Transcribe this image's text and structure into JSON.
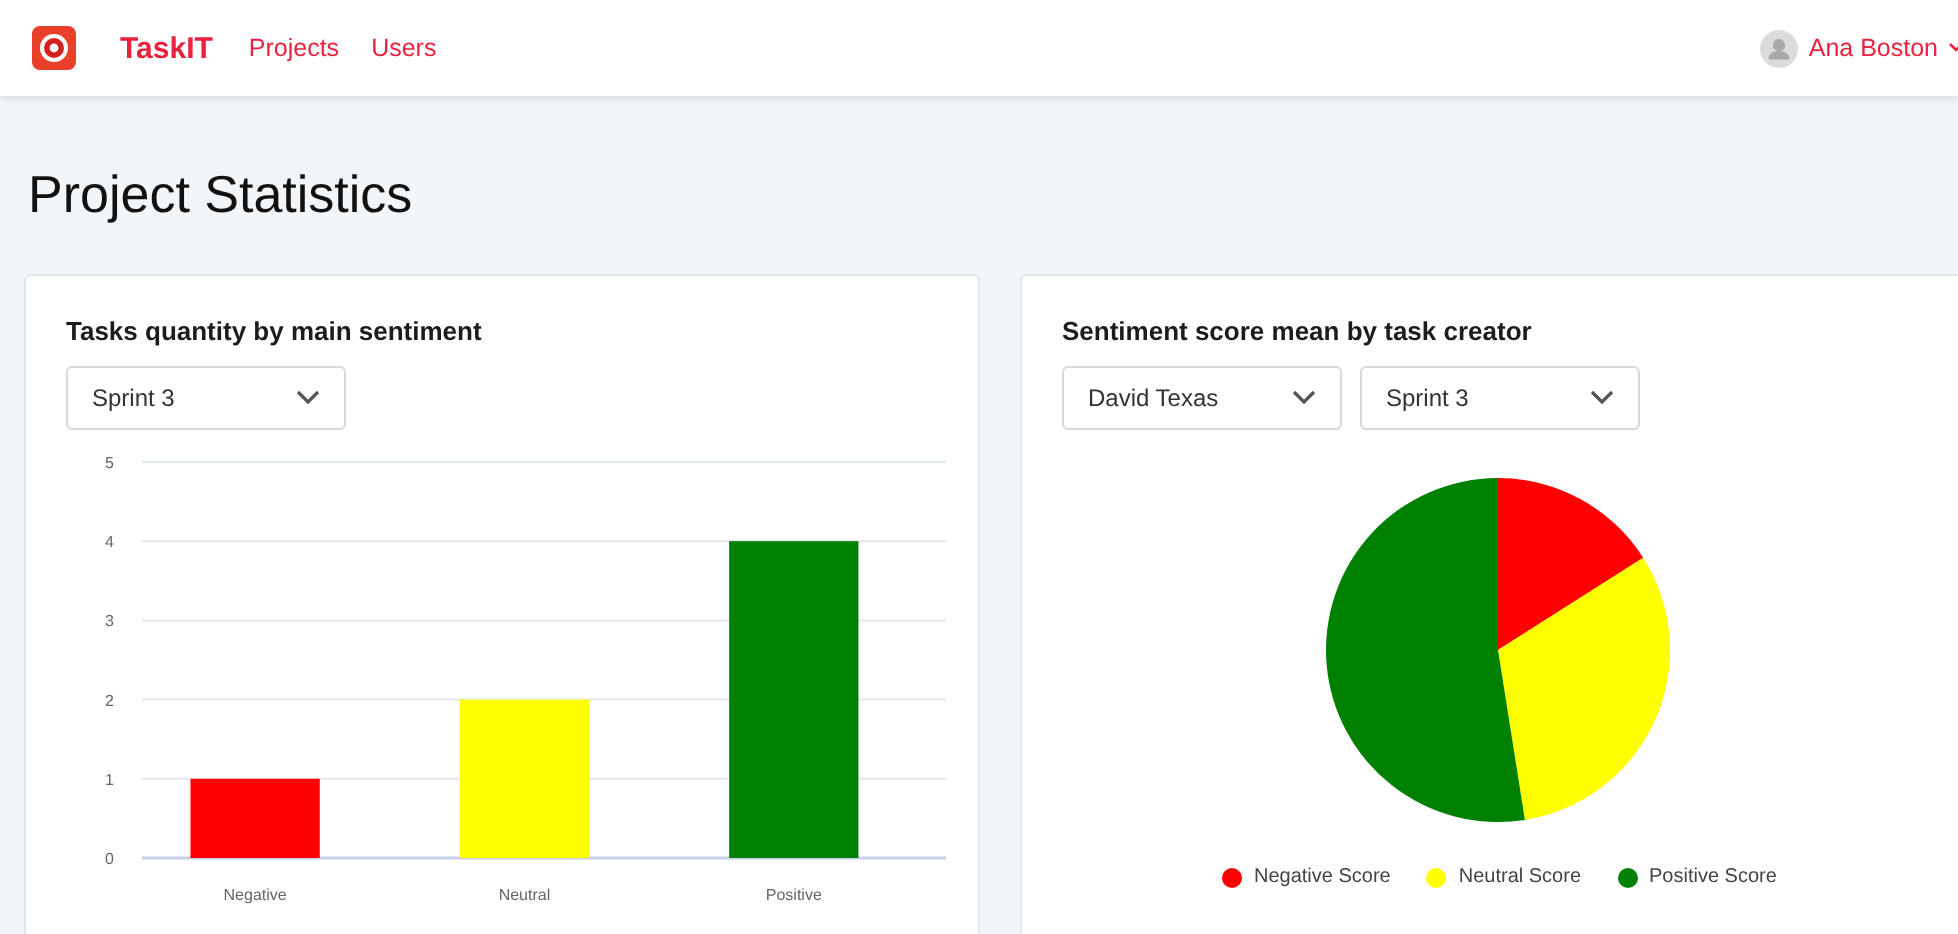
{
  "navbar": {
    "brand": "TaskIT",
    "links": [
      {
        "label": "Projects"
      },
      {
        "label": "Users"
      }
    ],
    "user": {
      "name": "Ana Boston"
    }
  },
  "page_title": "Project Statistics",
  "cards": [
    {
      "title": "Tasks quantity by main sentiment",
      "selects": [
        {
          "value": "Sprint 3"
        }
      ],
      "chart_data": {
        "type": "bar",
        "categories": [
          "Negative",
          "Neutral",
          "Positive"
        ],
        "grid": true,
        "ylim": [
          0,
          5
        ],
        "yticks": [
          0,
          1,
          2,
          3,
          4,
          5
        ],
        "values": [
          1,
          2,
          4
        ],
        "colors": [
          "#ff0000",
          "#ffff00",
          "#008000"
        ]
      }
    },
    {
      "title": "Sentiment score mean by task creator",
      "selects": [
        {
          "value": "David Texas"
        },
        {
          "value": "Sprint 3"
        }
      ],
      "legend": [
        {
          "label": "Negative Score",
          "color": "#ff0000"
        },
        {
          "label": "Neutral Score",
          "color": "#ffff00"
        },
        {
          "label": "Positive Score",
          "color": "#008000"
        }
      ]
    }
  ]
}
